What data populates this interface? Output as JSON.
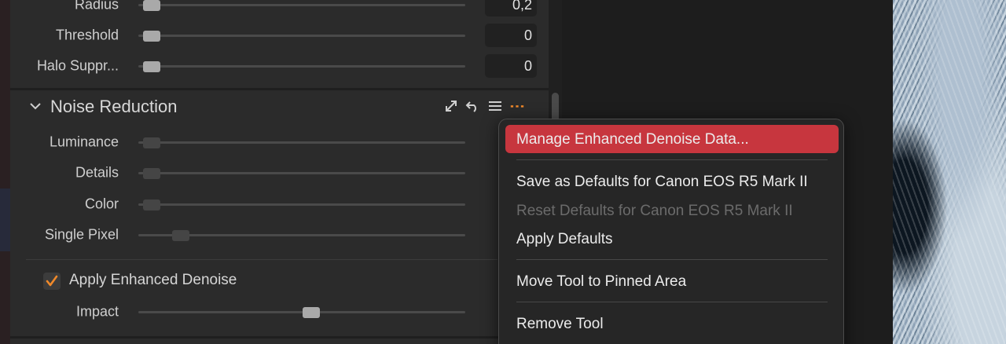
{
  "sharpening": {
    "rows": [
      {
        "label": "Radius",
        "value": "0,2",
        "pos": 0.04,
        "dim": false
      },
      {
        "label": "Threshold",
        "value": "0",
        "pos": 0.04,
        "dim": false
      },
      {
        "label": "Halo Suppr...",
        "value": "0",
        "pos": 0.04,
        "dim": false
      }
    ]
  },
  "noise_reduction": {
    "title": "Noise Reduction",
    "icons": [
      "expand-icon",
      "reset-icon",
      "presets-icon",
      "more-icon"
    ],
    "rows": [
      {
        "label": "Luminance",
        "pos": 0.04,
        "dim": true
      },
      {
        "label": "Details",
        "pos": 0.04,
        "dim": true
      },
      {
        "label": "Color",
        "pos": 0.04,
        "dim": true
      },
      {
        "label": "Single Pixel",
        "pos": 0.13,
        "dim": true
      }
    ],
    "enhanced_denoise": {
      "label": "Apply Enhanced Denoise",
      "checked": true,
      "impact_label": "Impact",
      "impact_pos": 0.53
    }
  },
  "context_menu": {
    "items": [
      {
        "label": "Manage Enhanced Denoise Data...",
        "highlighted": true,
        "disabled": false
      },
      {
        "label": "Save as Defaults for Canon EOS R5 Mark II",
        "highlighted": false,
        "disabled": false
      },
      {
        "label": "Reset Defaults for Canon EOS R5 Mark II",
        "highlighted": false,
        "disabled": true
      },
      {
        "label": "Apply Defaults",
        "highlighted": false,
        "disabled": false
      },
      {
        "label": "Move Tool to Pinned Area",
        "highlighted": false,
        "disabled": false
      },
      {
        "label": "Remove Tool",
        "highlighted": false,
        "disabled": false
      }
    ]
  },
  "colors": {
    "accent_orange": "#f0892a",
    "menu_highlight": "#c7363e"
  }
}
